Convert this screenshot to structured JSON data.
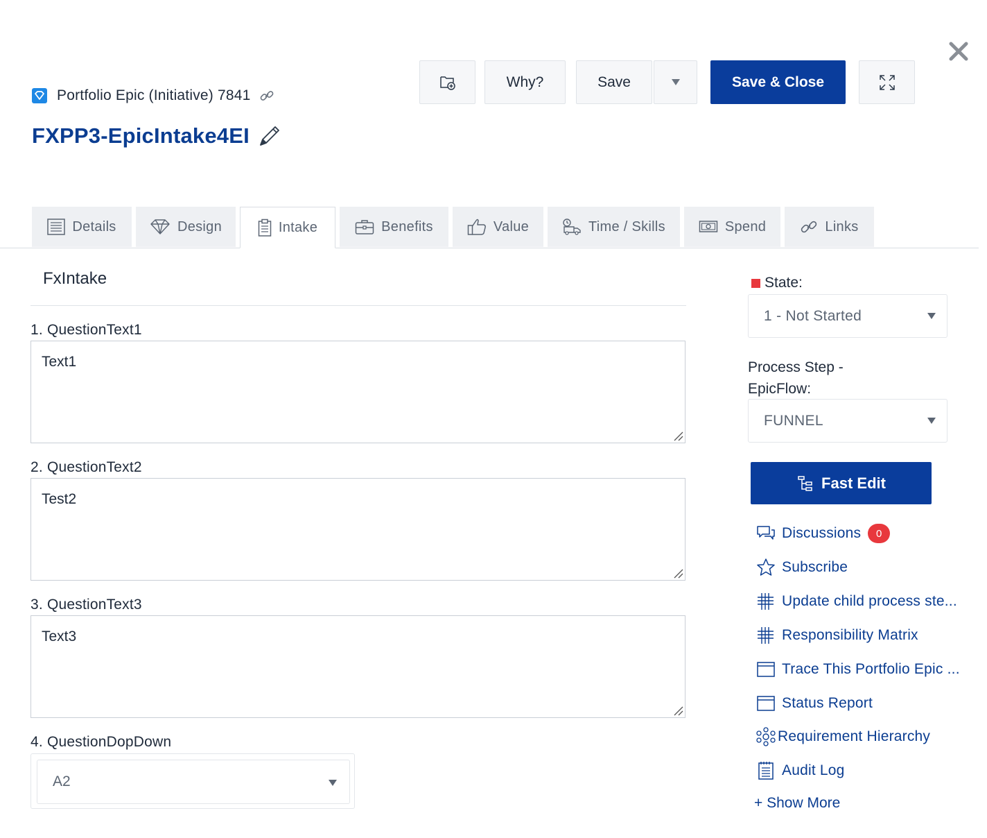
{
  "header": {
    "type_label": "Portfolio Epic (Initiative) 7841",
    "title": "FXPP3-EpicIntake4EI"
  },
  "toolbar": {
    "why_label": "Why?",
    "save_label": "Save",
    "save_close_label": "Save & Close"
  },
  "tabs": [
    {
      "label": "Details",
      "icon": "details-icon"
    },
    {
      "label": "Design",
      "icon": "diamond-icon"
    },
    {
      "label": "Intake",
      "icon": "clipboard-icon"
    },
    {
      "label": "Benefits",
      "icon": "briefcase-icon"
    },
    {
      "label": "Value",
      "icon": "thumbs-up-icon"
    },
    {
      "label": "Time / Skills",
      "icon": "delivery-truck-icon"
    },
    {
      "label": "Spend",
      "icon": "money-icon"
    },
    {
      "label": "Links",
      "icon": "link-icon"
    }
  ],
  "active_tab": "Intake",
  "form": {
    "section_title": "FxIntake",
    "questions": [
      {
        "label": "1.  QuestionText1",
        "value": "Text1"
      },
      {
        "label": "2.  QuestionText2",
        "value": "Test2"
      },
      {
        "label": "3.  QuestionText3",
        "value": "Text3"
      },
      {
        "label": "4.  QuestionDopDown",
        "value": "A2"
      }
    ]
  },
  "sidebar": {
    "state_label": "State:",
    "state_value": "1 - Not Started",
    "state_color": "#e8383d",
    "process_step_label": "Process Step - EpicFlow:",
    "process_step_value": "FUNNEL",
    "fast_edit_label": "Fast Edit",
    "links": [
      {
        "label": "Discussions",
        "icon": "discussions-icon",
        "badge": "0"
      },
      {
        "label": "Subscribe",
        "icon": "star-icon"
      },
      {
        "label": "Update child process ste...",
        "icon": "grid-hash-icon"
      },
      {
        "label": "Responsibility Matrix",
        "icon": "grid-hash-icon"
      },
      {
        "label": "Trace This Portfolio Epic ...",
        "icon": "window-icon"
      },
      {
        "label": "Status Report",
        "icon": "window-icon"
      },
      {
        "label": "Requirement Hierarchy",
        "icon": "hierarchy-icon"
      },
      {
        "label": "Audit Log",
        "icon": "notepad-icon"
      }
    ],
    "show_more_label": "+ Show More"
  },
  "colors": {
    "accent": "#0a3d9c",
    "link": "#0b3d91",
    "badge": "#e8383d"
  }
}
